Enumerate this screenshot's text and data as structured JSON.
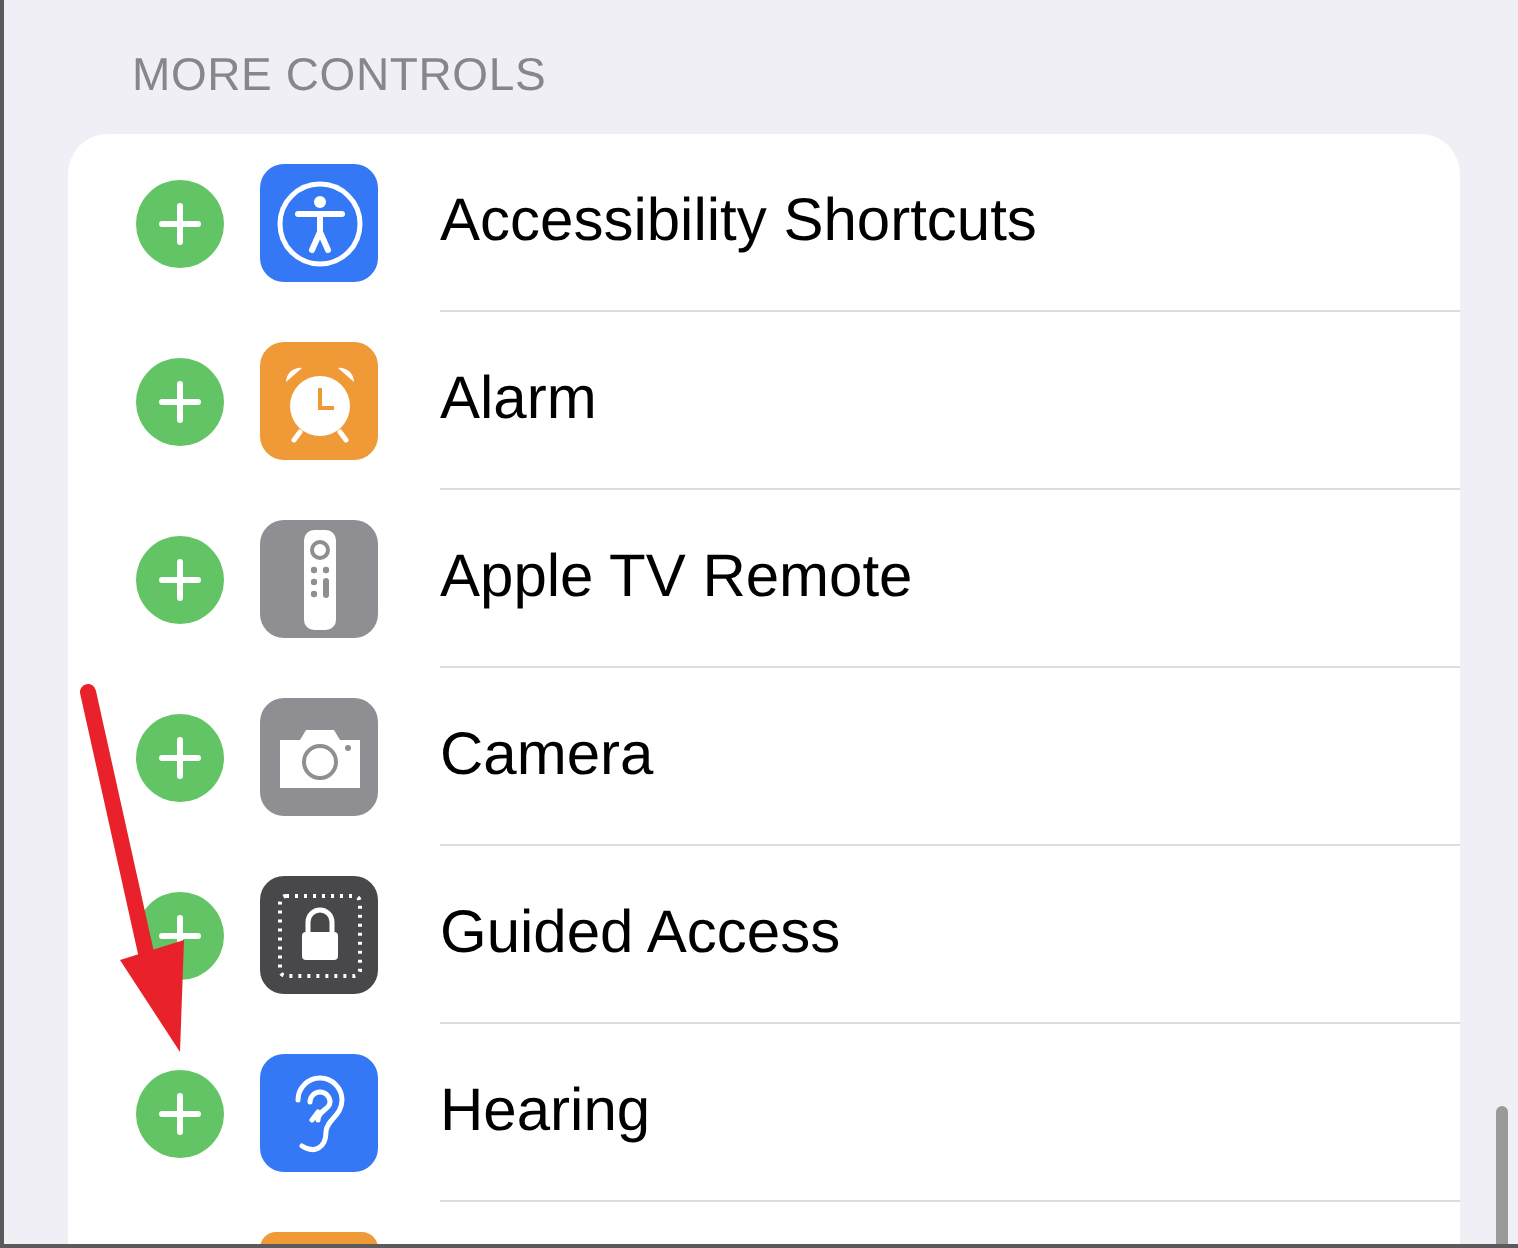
{
  "section_header": "MORE CONTROLS",
  "controls": [
    {
      "kind": "control",
      "label": "Accessibility Shortcuts",
      "color": "#3478f6"
    },
    {
      "kind": "control",
      "label": "Alarm",
      "color": "#f09a37"
    },
    {
      "kind": "control",
      "label": "Apple TV Remote",
      "color": "#8e8e93"
    },
    {
      "kind": "control",
      "label": "Camera",
      "color": "#8e8e93"
    },
    {
      "kind": "control",
      "label": "Guided Access",
      "color": "#48484a"
    },
    {
      "kind": "control",
      "label": "Hearing",
      "color": "#3478f6"
    },
    {
      "kind": "cut",
      "color": "#f09a37"
    }
  ]
}
